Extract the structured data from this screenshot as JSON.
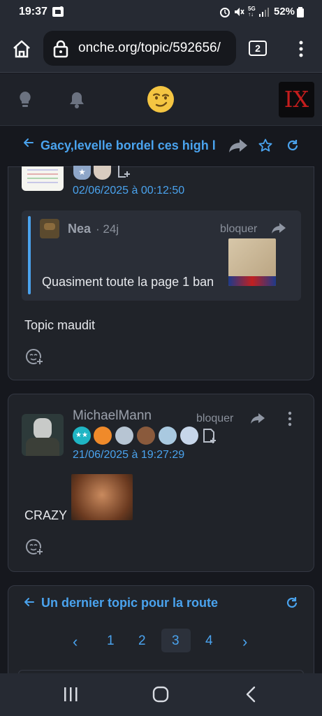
{
  "status_bar": {
    "time": "19:37",
    "battery": "52%"
  },
  "browser": {
    "url": "onche.org/topic/592656/",
    "tab_count": "2"
  },
  "topic": {
    "title": "Gacy,levelle bordel ces high l"
  },
  "post1": {
    "date": "02/06/2025 à 00:12:50",
    "quote": {
      "author": "Nea",
      "age": "· 24j",
      "block_label": "bloquer",
      "text": "Quasiment toute la page 1 ban"
    },
    "text": "Topic maudit"
  },
  "post2": {
    "author": "MichaelMann",
    "block_label": "bloquer",
    "date": "21/06/2025 à 19:27:29",
    "text": "CRAZY"
  },
  "pagination": {
    "next_topic": "Un dernier topic pour la route",
    "pages": [
      "1",
      "2",
      "3",
      "4"
    ],
    "current_page": "3",
    "prev_label": "‹",
    "next_label": "›"
  },
  "logo": {
    "text": "IX",
    "color": "#c41d1d"
  },
  "colors": {
    "accent": "#4aa3ee",
    "background": "#16181e",
    "card": "#202329"
  },
  "icons": [
    "home-icon",
    "lock-icon",
    "more-vert-icon",
    "lightbulb-icon",
    "bell-icon",
    "smiley-logo-icon",
    "arrow-left-icon",
    "share-icon",
    "star-icon",
    "refresh-icon",
    "add-reaction-icon",
    "add-file-icon"
  ]
}
